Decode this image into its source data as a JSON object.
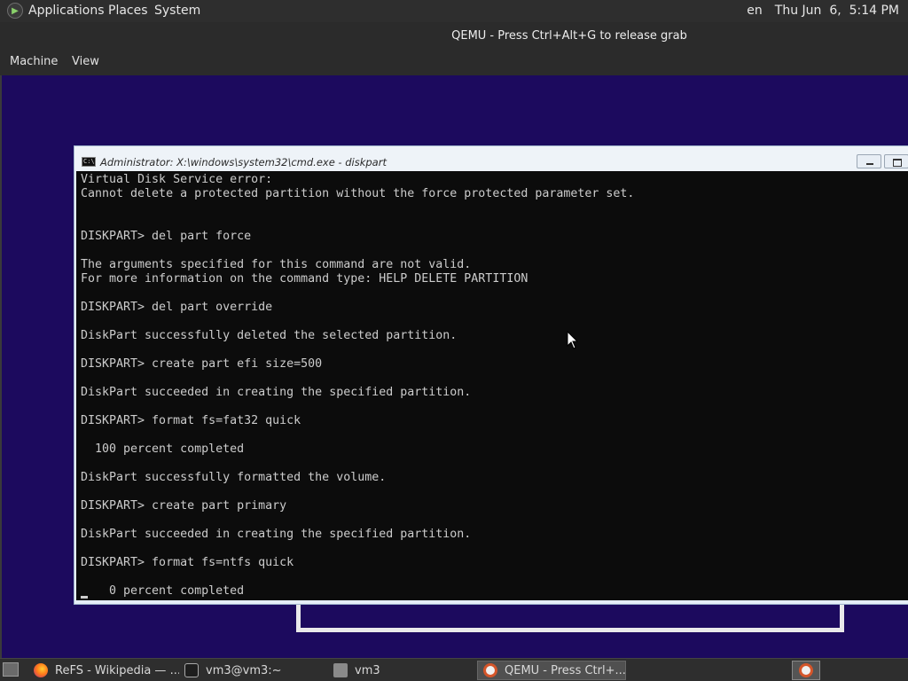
{
  "top_panel": {
    "menus": [
      "Applications",
      "Places",
      "System"
    ],
    "keyboard_layout": "en",
    "clock": "Thu Jun  6,  5:14 PM"
  },
  "qemu": {
    "title": "QEMU - Press Ctrl+Alt+G to release grab",
    "menus": [
      "Machine",
      "View"
    ]
  },
  "cmd_window": {
    "title": "Administrator: X:\\windows\\system32\\cmd.exe - diskpart",
    "icon_text": "C:\\",
    "lines": [
      "Virtual Disk Service error:",
      "Cannot delete a protected partition without the force protected parameter set.",
      "",
      "",
      "DISKPART> del part force",
      "",
      "The arguments specified for this command are not valid.",
      "For more information on the command type: HELP DELETE PARTITION",
      "",
      "DISKPART> del part override",
      "",
      "DiskPart successfully deleted the selected partition.",
      "",
      "DISKPART> create part efi size=500",
      "",
      "DiskPart succeeded in creating the specified partition.",
      "",
      "DISKPART> format fs=fat32 quick",
      "",
      "  100 percent completed",
      "",
      "DiskPart successfully formatted the volume.",
      "",
      "DISKPART> create part primary",
      "",
      "DiskPart succeeded in creating the specified partition.",
      "",
      "DISKPART> format fs=ntfs quick",
      "",
      "    0 percent completed"
    ]
  },
  "taskbar": {
    "items": [
      {
        "label": "ReFS - Wikipedia — ...",
        "icon": "firefox-icon"
      },
      {
        "label": "vm3@vm3:~",
        "icon": "terminal-icon"
      },
      {
        "label": "vm3",
        "icon": "folder-icon"
      },
      {
        "label": "QEMU - Press Ctrl+...",
        "icon": "qemu-icon",
        "active": true
      }
    ]
  },
  "colors": {
    "vm_background": "#1c0a5e",
    "console_background": "#0c0c0c",
    "console_text": "#cccccc",
    "panel_background": "#2e2e2e"
  }
}
